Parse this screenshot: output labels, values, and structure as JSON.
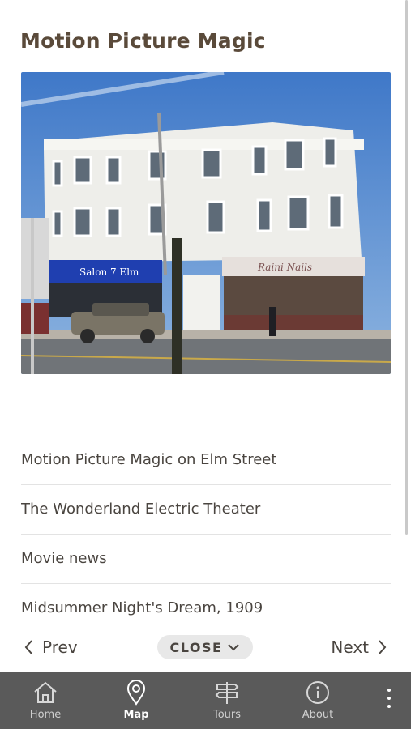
{
  "header": {
    "title": "Motion Picture Magic"
  },
  "photo": {
    "storefront_left": "Salon 7 Elm",
    "storefront_right": "Raini Nails"
  },
  "links": [
    {
      "label": "Motion Picture Magic on Elm Street"
    },
    {
      "label": "The Wonderland Electric Theater"
    },
    {
      "label": "Movie news"
    },
    {
      "label": "Midsummer Night's Dream, 1909"
    }
  ],
  "pager": {
    "prev_label": "Prev",
    "close_label": "CLOSE",
    "next_label": "Next"
  },
  "tabs": [
    {
      "label": "Home",
      "icon": "home-icon",
      "active": false
    },
    {
      "label": "Map",
      "icon": "map-pin-icon",
      "active": true
    },
    {
      "label": "Tours",
      "icon": "signpost-icon",
      "active": false
    },
    {
      "label": "About",
      "icon": "info-icon",
      "active": false
    }
  ],
  "colors": {
    "title": "#5a4a3a",
    "tabbar": "#5a5a5a",
    "close_bg": "#e8e8e8"
  }
}
